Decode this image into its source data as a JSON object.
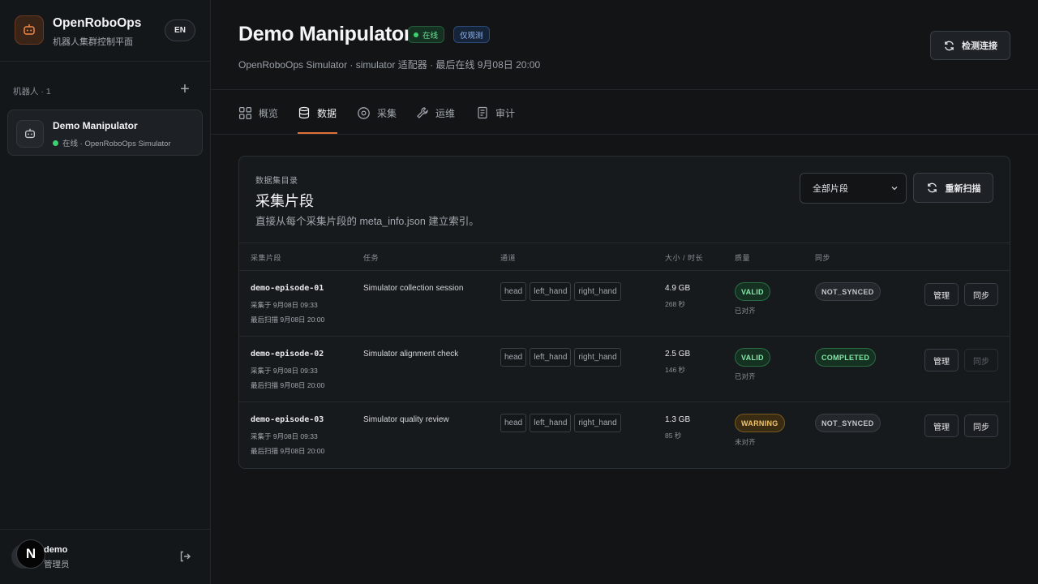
{
  "brand": {
    "title": "OpenRoboOps",
    "subtitle": "机器人集群控制平面",
    "lang": "EN"
  },
  "sidebar": {
    "robots_label": "机器人 · 1",
    "add_symbol": "+",
    "robot": {
      "name": "Demo Manipulator",
      "status": "在线 · OpenRoboOps Simulator"
    },
    "user": {
      "initial": "N",
      "name": "demo",
      "role": "管理员"
    }
  },
  "header": {
    "title": "Demo Manipulator",
    "status_badge": "在线",
    "mode_badge": "仅观测",
    "subline": "OpenRoboOps Simulator · simulator 适配器 · 最后在线 9月08日 20:00",
    "detect_button": "检测连接"
  },
  "tabs": [
    {
      "label": "概览",
      "icon": "grid-icon"
    },
    {
      "label": "数据",
      "icon": "database-icon"
    },
    {
      "label": "采集",
      "icon": "record-icon"
    },
    {
      "label": "运维",
      "icon": "wrench-icon"
    },
    {
      "label": "审计",
      "icon": "document-icon"
    }
  ],
  "active_tab": "数据",
  "catalog": {
    "kicker": "数据集目录",
    "title": "采集片段",
    "description": "直接从每个采集片段的 meta_info.json 建立索引。",
    "filter_value": "全部片段",
    "rescan_button": "重新扫描",
    "columns": [
      "采集片段",
      "任务",
      "通道",
      "大小 / 时长",
      "质量",
      "同步"
    ],
    "episodes": [
      {
        "id": "demo-episode-01",
        "captured": "采集于 9月08日 09:33",
        "scanned": "最后扫描 9月08日 20:00",
        "task": "Simulator collection session",
        "channels": [
          "head",
          "left_hand",
          "right_hand"
        ],
        "size": "4.9 GB",
        "duration": "268 秒",
        "quality": "VALID",
        "quality_note": "已对齐",
        "sync": "NOT_SYNCED",
        "manage": "管理",
        "sync_button": "同步"
      },
      {
        "id": "demo-episode-02",
        "captured": "采集于 9月08日 09:33",
        "scanned": "最后扫描 9月08日 20:00",
        "task": "Simulator alignment check",
        "channels": [
          "head",
          "left_hand",
          "right_hand"
        ],
        "size": "2.5 GB",
        "duration": "146 秒",
        "quality": "VALID",
        "quality_note": "已对齐",
        "sync": "COMPLETED",
        "manage": "管理",
        "sync_button": "同步"
      },
      {
        "id": "demo-episode-03",
        "captured": "采集于 9月08日 09:33",
        "scanned": "最后扫描 9月08日 20:00",
        "task": "Simulator quality review",
        "channels": [
          "head",
          "left_hand",
          "right_hand"
        ],
        "size": "1.3 GB",
        "duration": "85 秒",
        "quality": "WARNING",
        "quality_note": "未对齐",
        "sync": "NOT_SYNCED",
        "manage": "管理",
        "sync_button": "同步"
      }
    ]
  },
  "colors": {
    "accent": "#e0703a",
    "online": "#3ecf6e",
    "background": "#121416"
  }
}
